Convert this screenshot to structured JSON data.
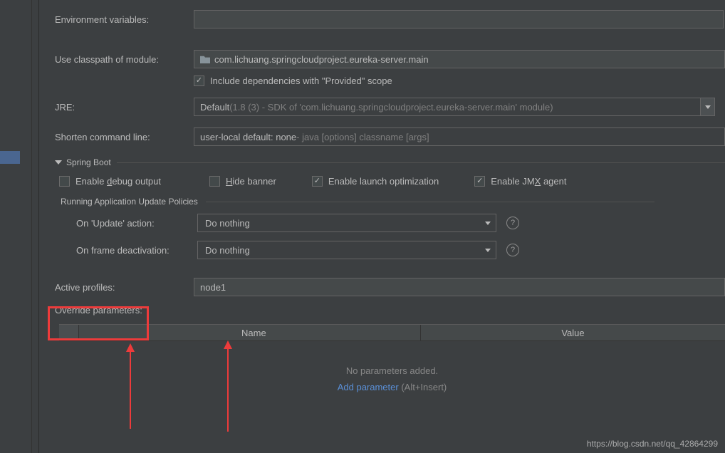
{
  "labels": {
    "env_vars": "Environment variables:",
    "classpath": "Use classpath of module:",
    "include_provided": "Include dependencies with \"Provided\" scope",
    "jre": "JRE:",
    "shorten": "Shorten command line:",
    "spring_boot": "Spring Boot",
    "enable_debug_pre": "Enable ",
    "enable_debug_u": "d",
    "enable_debug_post": "ebug output",
    "hide_banner_u": "H",
    "hide_banner_post": "ide banner",
    "enable_launch": "Enable launch optimization",
    "enable_jmx_pre": "Enable JM",
    "enable_jmx_u": "X",
    "enable_jmx_post": " agent",
    "update_policies": "Running Application Update Policies",
    "on_update": "On 'Update' action:",
    "on_frame": "On frame deactivation:",
    "active_profiles": "Active profiles:",
    "override": "Override parameters:",
    "col_name": "Name",
    "col_value": "Value",
    "no_params": "No parameters added.",
    "add_param": "Add parameter",
    "add_hint": " (Alt+Insert)"
  },
  "values": {
    "env_vars": "",
    "module": "com.lichuang.springcloudproject.eureka-server.main",
    "include_provided_checked": true,
    "jre_prefix": "Default ",
    "jre_suffix": "(1.8 (3) - SDK of 'com.lichuang.springcloudproject.eureka-server.main' module)",
    "shorten_prefix": "user-local default: none ",
    "shorten_suffix": "- java [options] classname [args]",
    "enable_debug_checked": false,
    "hide_banner_checked": false,
    "enable_launch_checked": true,
    "enable_jmx_checked": true,
    "on_update": "Do nothing",
    "on_frame": "Do nothing",
    "active_profiles": "node1"
  },
  "watermark": "https://blog.csdn.net/qq_42864299"
}
